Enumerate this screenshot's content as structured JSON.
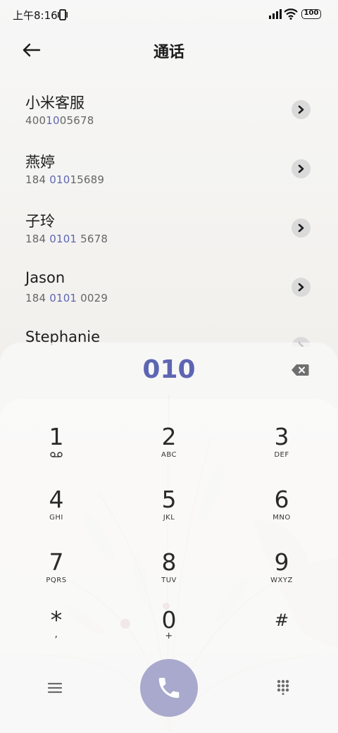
{
  "status_bar": {
    "time": "上午8:16",
    "battery": "100"
  },
  "header": {
    "title": "通话"
  },
  "contacts": [
    {
      "name": "小米客服",
      "number_pre": "400",
      "number_match": "10",
      "number_post": "05678"
    },
    {
      "name": "燕婷",
      "number_pre": "184 ",
      "number_match": "010",
      "number_post": "15689"
    },
    {
      "name": "子玲",
      "number_pre": "184 ",
      "number_match": "0101",
      "number_post": " 5678"
    },
    {
      "name": "Jason",
      "number_pre": "184 ",
      "number_match": "0101",
      "number_post": " 0029"
    },
    {
      "name": "Stephanie",
      "number_pre": "",
      "number_match": "",
      "number_post": ""
    }
  ],
  "dial": {
    "number": "010"
  },
  "keys": [
    {
      "digit": "1",
      "letters": ""
    },
    {
      "digit": "2",
      "letters": "ABC"
    },
    {
      "digit": "3",
      "letters": "DEF"
    },
    {
      "digit": "4",
      "letters": "GHI"
    },
    {
      "digit": "5",
      "letters": "JKL"
    },
    {
      "digit": "6",
      "letters": "MNO"
    },
    {
      "digit": "7",
      "letters": "PQRS"
    },
    {
      "digit": "8",
      "letters": "TUV"
    },
    {
      "digit": "9",
      "letters": "WXYZ"
    },
    {
      "digit": "*",
      "letters": ","
    },
    {
      "digit": "0",
      "letters": "+"
    },
    {
      "digit": "#",
      "letters": ""
    }
  ],
  "icons": {
    "back": "arrow-left-icon",
    "detail": "chevron-right-icon",
    "backspace": "backspace-icon",
    "voicemail": "voicemail-icon",
    "menu": "menu-icon",
    "call": "phone-icon",
    "keypad": "dialpad-icon"
  },
  "colors": {
    "accent": "#5d65b3",
    "call_button": "#a8a9cc",
    "text": "#222222"
  }
}
